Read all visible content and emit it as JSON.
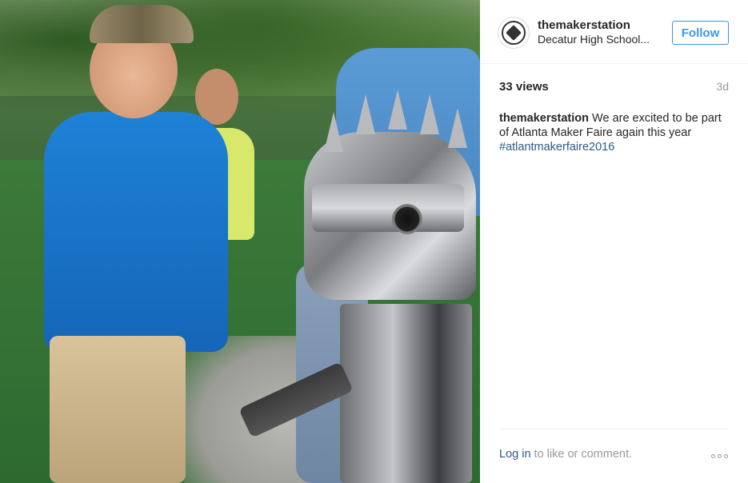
{
  "media": {
    "alt_icon": "video-frame"
  },
  "post": {
    "username": "themakerstation",
    "location": "Decatur High School...",
    "follow_label": "Follow",
    "views": "33 views",
    "time": "3d",
    "caption_user": "themakerstation",
    "caption_text": " We are excited to be part of Atlanta Maker Faire again this year",
    "hashtag": "#atlantmakerfaire2016",
    "login_link": "Log in",
    "login_suffix": " to like or comment.",
    "more_icon": "ellipsis-icon"
  },
  "colors": {
    "link": "#2a5b8b",
    "follow": "#3897f0",
    "muted": "#999999"
  }
}
